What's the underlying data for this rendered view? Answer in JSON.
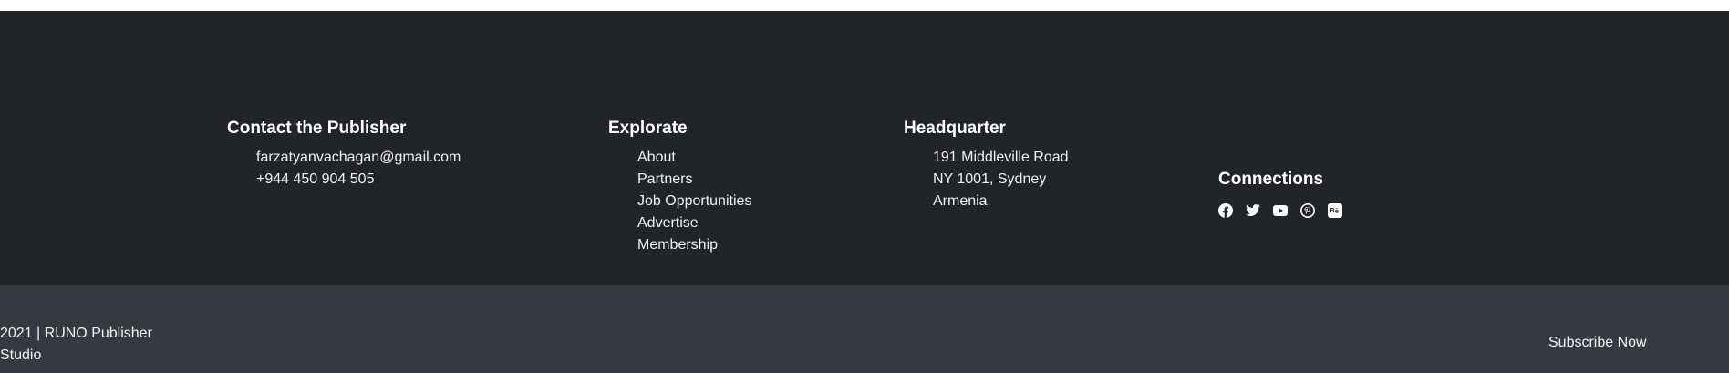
{
  "contact": {
    "title": "Contact the Publisher",
    "email": "farzatyanvachagan@gmail.com",
    "phone": "+944 450 904 505"
  },
  "explore": {
    "title": "Explorate",
    "links": [
      "About",
      "Partners",
      "Job Opportunities",
      "Advertise",
      "Membership"
    ]
  },
  "headquarter": {
    "title": "Headquarter",
    "lines": [
      "191 Middleville Road",
      "NY 1001, Sydney",
      "Armenia"
    ]
  },
  "connections": {
    "title": "Connections",
    "icons": [
      "facebook-icon",
      "twitter-icon",
      "youtube-icon",
      "pinterest-icon",
      "behance-icon"
    ]
  },
  "bottom": {
    "copyright": "2021 | RUNO Publisher Studio",
    "subscribe_label": "Subscribe Now"
  },
  "colors": {
    "footer_bg": "#212429",
    "bottom_bg": "#353940",
    "text": "#f0f1f3"
  }
}
